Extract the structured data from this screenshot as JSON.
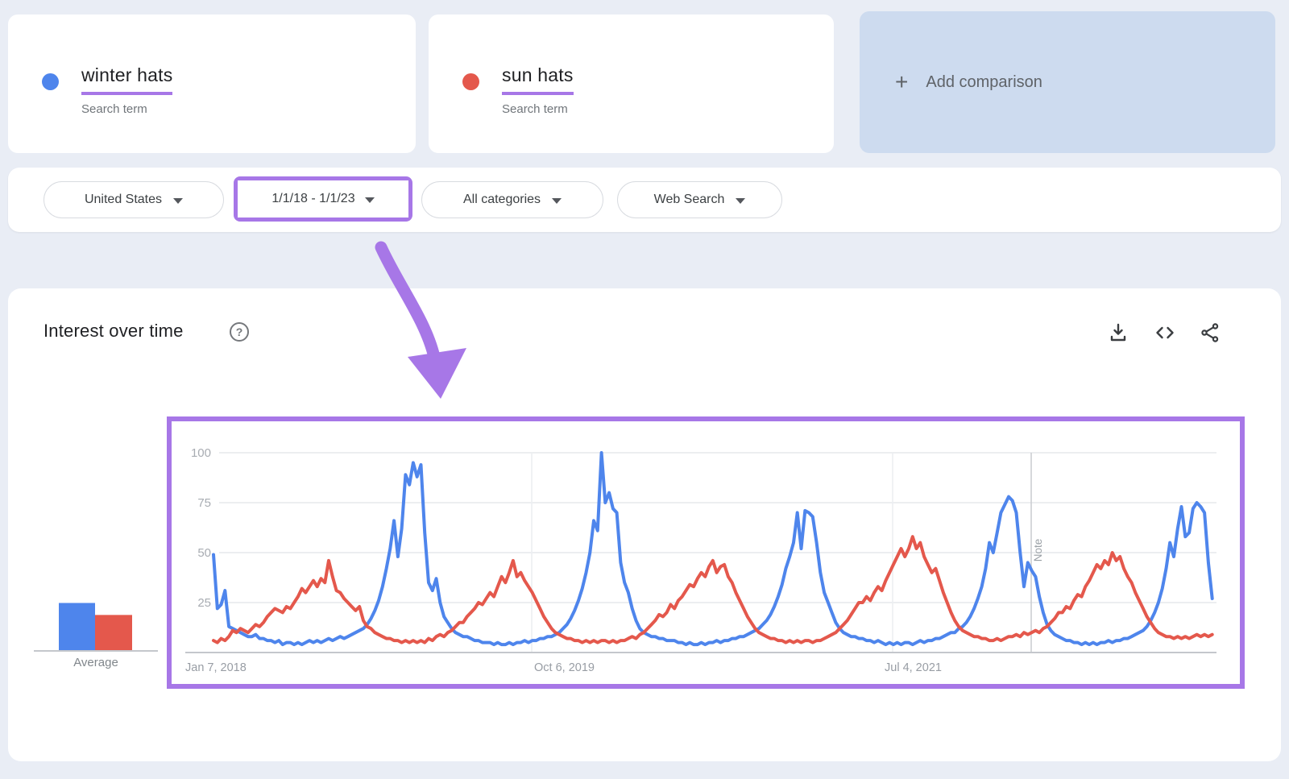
{
  "accent": {
    "purple": "#a777e7"
  },
  "terms": [
    {
      "label": "winter hats",
      "sublabel": "Search term",
      "color": "#4e85ec"
    },
    {
      "label": "sun hats",
      "sublabel": "Search term",
      "color": "#e4584c"
    }
  ],
  "add_comparison": {
    "plus_icon": "+",
    "label": "Add comparison"
  },
  "filters": {
    "region": "United States",
    "time_range": "1/1/18 - 1/1/23",
    "category": "All categories",
    "search_type": "Web Search"
  },
  "panel": {
    "title": "Interest over time",
    "help_icon": "?"
  },
  "average": {
    "label": "Average"
  },
  "chart_data": {
    "type": "line",
    "title": "Interest over time",
    "ylim": [
      0,
      100
    ],
    "y_ticks": [
      25,
      50,
      75,
      100
    ],
    "grid": true,
    "legend": "none",
    "x_tick_labels": [
      "Jan 7, 2018",
      "Oct 6, 2019",
      "Jul 4, 2021"
    ],
    "note_label": "Note",
    "series": [
      {
        "name": "winter hats",
        "color": "#4e85ec",
        "average": 24,
        "values": [
          49,
          22,
          24,
          31,
          13,
          12,
          11,
          10,
          9,
          8,
          8,
          9,
          7,
          7,
          6,
          6,
          5,
          6,
          4,
          5,
          5,
          4,
          5,
          4,
          5,
          6,
          5,
          6,
          5,
          6,
          7,
          6,
          7,
          8,
          7,
          8,
          9,
          10,
          11,
          12,
          14,
          17,
          21,
          26,
          33,
          42,
          52,
          66,
          48,
          62,
          89,
          84,
          95,
          88,
          94,
          60,
          35,
          31,
          37,
          25,
          18,
          15,
          12,
          10,
          9,
          8,
          8,
          7,
          6,
          6,
          5,
          5,
          5,
          4,
          5,
          4,
          4,
          5,
          4,
          5,
          5,
          6,
          5,
          6,
          6,
          7,
          7,
          8,
          8,
          9,
          10,
          12,
          14,
          17,
          21,
          26,
          32,
          40,
          50,
          66,
          61,
          100,
          75,
          80,
          72,
          70,
          45,
          35,
          30,
          22,
          16,
          12,
          10,
          9,
          8,
          8,
          7,
          7,
          6,
          6,
          6,
          5,
          5,
          4,
          5,
          4,
          4,
          5,
          4,
          5,
          5,
          6,
          5,
          6,
          6,
          7,
          7,
          8,
          8,
          9,
          10,
          11,
          12,
          14,
          16,
          19,
          23,
          28,
          34,
          42,
          48,
          55,
          70,
          52,
          71,
          70,
          68,
          55,
          40,
          30,
          25,
          20,
          15,
          12,
          10,
          9,
          8,
          8,
          7,
          7,
          6,
          6,
          5,
          6,
          5,
          4,
          5,
          4,
          5,
          4,
          5,
          5,
          4,
          5,
          6,
          5,
          6,
          6,
          7,
          7,
          8,
          9,
          10,
          10,
          12,
          13,
          15,
          18,
          22,
          27,
          33,
          42,
          55,
          50,
          60,
          70,
          74,
          78,
          76,
          70,
          50,
          33,
          45,
          41,
          38,
          28,
          20,
          14,
          11,
          9,
          8,
          7,
          6,
          6,
          5,
          5,
          4,
          5,
          4,
          5,
          4,
          5,
          5,
          6,
          5,
          6,
          6,
          7,
          7,
          8,
          9,
          10,
          11,
          13,
          16,
          20,
          25,
          32,
          42,
          55,
          48,
          62,
          73,
          58,
          60,
          72,
          75,
          73,
          70,
          45,
          27
        ]
      },
      {
        "name": "sun hats",
        "color": "#e4584c",
        "average": 18,
        "values": [
          6,
          5,
          7,
          6,
          8,
          11,
          10,
          12,
          11,
          10,
          12,
          14,
          13,
          15,
          18,
          20,
          22,
          21,
          20,
          23,
          22,
          25,
          28,
          32,
          30,
          33,
          36,
          33,
          37,
          35,
          46,
          38,
          31,
          30,
          27,
          25,
          23,
          21,
          23,
          16,
          13,
          12,
          10,
          9,
          8,
          7,
          7,
          6,
          6,
          5,
          6,
          5,
          6,
          5,
          6,
          5,
          7,
          6,
          8,
          9,
          8,
          10,
          11,
          13,
          15,
          15,
          18,
          20,
          22,
          25,
          24,
          27,
          30,
          28,
          33,
          38,
          35,
          40,
          46,
          38,
          40,
          36,
          33,
          30,
          26,
          22,
          18,
          15,
          12,
          10,
          9,
          8,
          7,
          7,
          6,
          6,
          5,
          6,
          5,
          6,
          5,
          6,
          6,
          5,
          6,
          5,
          6,
          6,
          7,
          8,
          7,
          9,
          10,
          12,
          14,
          16,
          19,
          18,
          20,
          24,
          22,
          26,
          28,
          31,
          34,
          33,
          37,
          40,
          38,
          43,
          46,
          40,
          43,
          44,
          38,
          35,
          30,
          26,
          22,
          18,
          15,
          12,
          10,
          9,
          8,
          7,
          7,
          6,
          6,
          5,
          6,
          5,
          6,
          5,
          6,
          6,
          5,
          6,
          6,
          7,
          8,
          9,
          10,
          12,
          14,
          16,
          19,
          22,
          25,
          25,
          28,
          26,
          30,
          33,
          31,
          36,
          40,
          44,
          48,
          52,
          48,
          52,
          58,
          52,
          55,
          48,
          44,
          40,
          42,
          36,
          30,
          25,
          20,
          16,
          13,
          11,
          10,
          9,
          8,
          8,
          7,
          7,
          6,
          6,
          7,
          6,
          7,
          8,
          8,
          9,
          8,
          10,
          9,
          10,
          11,
          10,
          12,
          13,
          15,
          17,
          20,
          20,
          23,
          22,
          26,
          29,
          28,
          33,
          36,
          40,
          44,
          42,
          46,
          44,
          50,
          46,
          48,
          42,
          38,
          35,
          30,
          26,
          22,
          18,
          15,
          12,
          10,
          9,
          8,
          8,
          7,
          8,
          7,
          8,
          7,
          8,
          9,
          8,
          9,
          8,
          9
        ]
      }
    ]
  }
}
